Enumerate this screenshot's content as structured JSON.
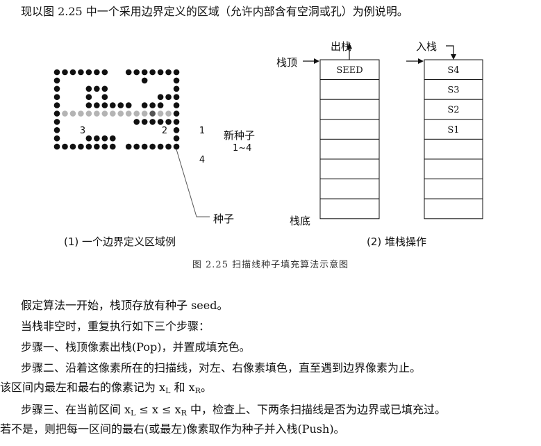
{
  "intro": "现以图 2.25 中一个采用边界定义的区域（允许内部含有空洞或孔）为例说明。",
  "figure": {
    "caption": "图 2.25   扫描线种子填充算法示意图",
    "left": {
      "label": "(1) 一个边界定义区域例",
      "new_seed_label": "新种子",
      "new_seed_range": "1~4",
      "seed_label": "种子",
      "markers": [
        "1",
        "2",
        "3",
        "4"
      ]
    },
    "right": {
      "label": "(2) 堆栈操作",
      "pop_label": "出栈",
      "push_label": "入栈",
      "top_label": "栈顶",
      "bottom_label": "栈底",
      "stack1": [
        "SEED",
        "",
        "",
        "",
        "",
        "",
        "",
        ""
      ],
      "stack2": [
        "S4",
        "S3",
        "S2",
        "S1",
        "",
        "",
        "",
        ""
      ]
    }
  },
  "body": {
    "p1": "假定算法一开始，栈顶存放有种子 seed。",
    "p2": "当栈非空时，重复执行如下三个步骤：",
    "p3": "步骤一、栈顶像素出栈(Pop)，并置成填充色。",
    "p4": "步骤二、沿着这像素所在的扫描线，对左、右像素填色，直至遇到边界像素为止。",
    "p5a": "该区间内最左和最右的像素记为 x",
    "p5_sub1": "L",
    "p5b": " 和 x",
    "p5_sub2": "R",
    "p5c": "。",
    "p6a": "步骤三、在当前区间 x",
    "p6_sub1": "L",
    "p6b": " ≤ x ≤ x",
    "p6_sub2": "R",
    "p6c": " 中，检查上、下两条扫描线是否为边界或已填充过。",
    "p7": "若不是，则把每一区间的最右(或最左)像素取作为种子并入栈(Push)。"
  },
  "colors": {
    "boundary": "#111111",
    "filled": "#b4b4b4",
    "seed": "#555555"
  }
}
